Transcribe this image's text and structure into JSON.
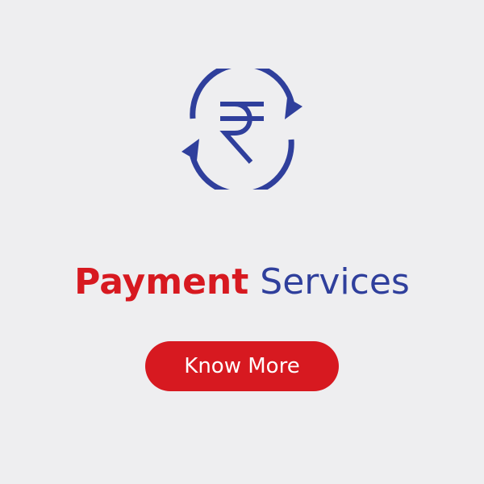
{
  "icon": {
    "name": "rupee-exchange-icon",
    "color": "#2f3f9c"
  },
  "title": {
    "strong": "Payment",
    "light": "Services",
    "strong_color": "#d71920",
    "light_color": "#2f3f9c"
  },
  "cta": {
    "label": "Know More",
    "background": "#d71920",
    "text_color": "#ffffff"
  },
  "background_color": "#eeeef0"
}
